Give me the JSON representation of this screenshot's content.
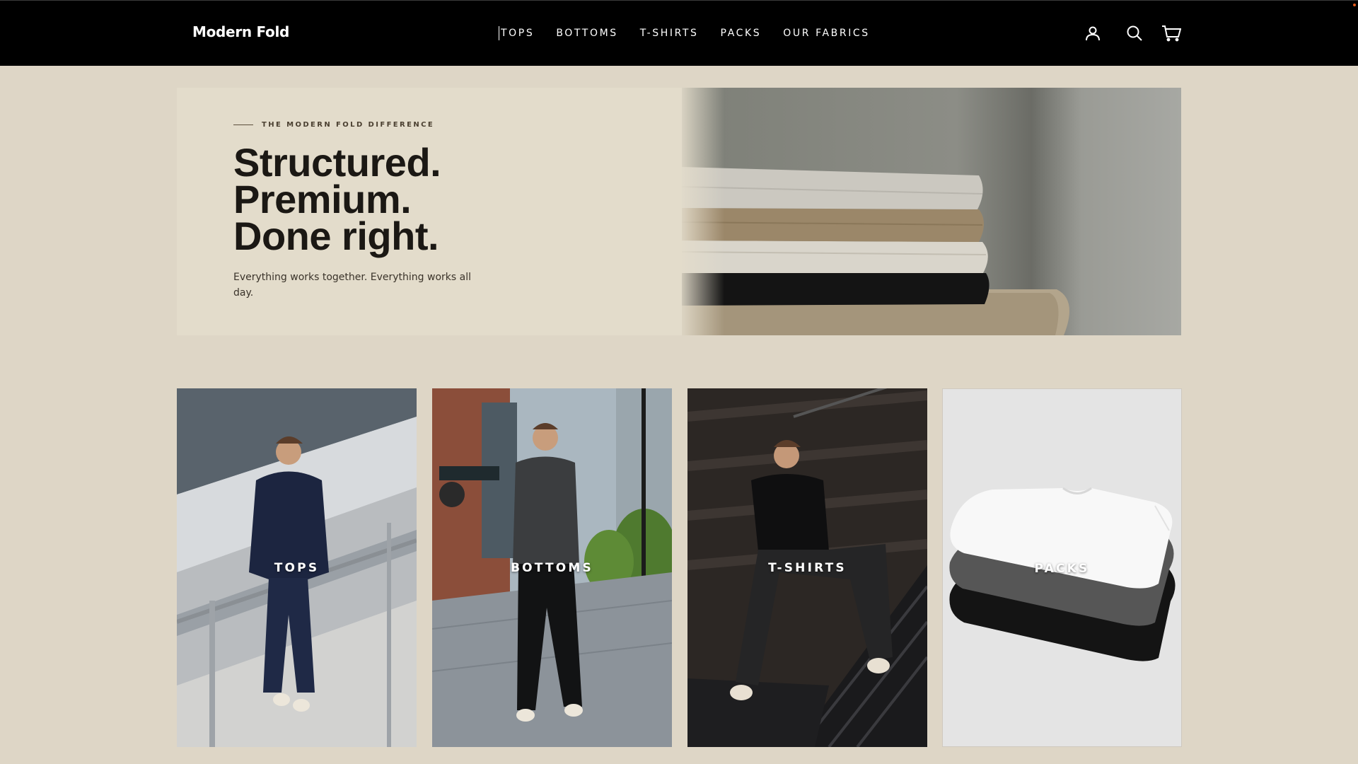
{
  "brand": {
    "logo_text": "Modern Fold"
  },
  "nav": {
    "items": [
      {
        "label": "TOPS"
      },
      {
        "label": "BOTTOMS"
      },
      {
        "label": "T-SHIRTS"
      },
      {
        "label": "PACKS"
      },
      {
        "label": "OUR FABRICS"
      }
    ]
  },
  "header_icons": [
    "account-icon",
    "search-icon",
    "cart-icon"
  ],
  "hero": {
    "eyebrow": "THE MODERN FOLD DIFFERENCE",
    "headline": [
      "Structured.",
      "Premium.",
      "Done right."
    ],
    "subtext": "Everything works together. Everything works all day."
  },
  "categories": [
    {
      "label": "TOPS"
    },
    {
      "label": "BOTTOMS"
    },
    {
      "label": "T-SHIRTS"
    },
    {
      "label": "PACKS"
    }
  ],
  "colors": {
    "page_background": "#ded6c6",
    "hero_panel": "#e3dccb",
    "header_background": "#000000",
    "text_dark": "#1b1814"
  }
}
